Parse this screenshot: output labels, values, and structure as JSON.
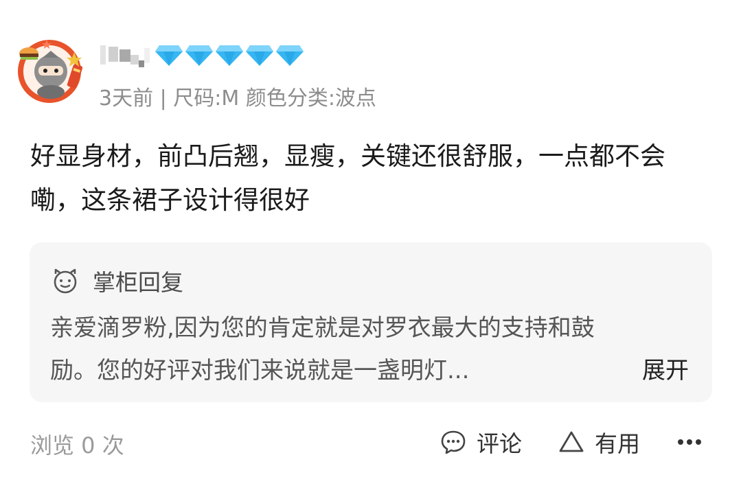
{
  "reviewer": {
    "avatar_icon": "cartoon-ninja-avatar-icon",
    "name_masked": "",
    "level_icon": "diamond-icon",
    "level_count": 5,
    "level_color": "#36b6f2"
  },
  "meta": {
    "time": "3天前",
    "separator": "|",
    "sku": "尺码:M 颜色分类:波点"
  },
  "review": {
    "text": "好显身材，前凸后翘，显瘦，关键还很舒服，一点都不会嘞，这条裙子设计得很好"
  },
  "seller_reply": {
    "icon": "smile-face-icon",
    "title": "掌柜回复",
    "line1": "亲爱滴罗粉,因为您的肯定就是对罗衣最大的支持和鼓",
    "line2": "励。您的好评对我们来说就是一盏明灯...",
    "expand_label": "展开"
  },
  "footer": {
    "views_label": "浏览 0 次",
    "comment_label": "评论",
    "comment_icon": "comment-bubble-icon",
    "useful_label": "有用",
    "useful_icon": "triangle-like-icon",
    "more_icon": "more-dots-icon"
  },
  "colors": {
    "meta_text": "#8c8c8c",
    "reply_bg": "#f6f6f6",
    "diamond": "#36b6f2",
    "avatar_ring": "#e8532b"
  }
}
